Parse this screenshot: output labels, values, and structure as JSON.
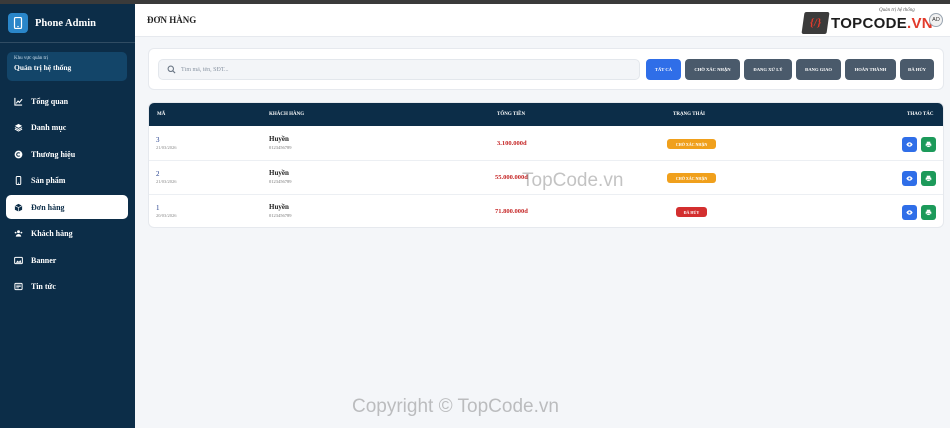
{
  "app": {
    "brand": "Phone Admin"
  },
  "area": {
    "subtitle": "Khu vực quản trị",
    "title": "Quản trị hệ thống"
  },
  "nav": {
    "items": [
      {
        "label": "Tổng quan",
        "icon": "chart-line-icon"
      },
      {
        "label": "Danh mục",
        "icon": "layers-icon"
      },
      {
        "label": "Thương hiệu",
        "icon": "copyright-icon"
      },
      {
        "label": "Sản phẩm",
        "icon": "mobile-icon"
      },
      {
        "label": "Đơn hàng",
        "icon": "box-icon",
        "active": true
      },
      {
        "label": "Khách hàng",
        "icon": "users-icon"
      },
      {
        "label": "Banner",
        "icon": "image-icon"
      },
      {
        "label": "Tin tức",
        "icon": "newspaper-icon"
      }
    ]
  },
  "header": {
    "title": "ĐƠN HÀNG",
    "logo_mark": "{/}",
    "logo_text_a": "TOPCODE",
    "logo_text_b": ".VN",
    "logo_slogan": "Quản trị hệ thống",
    "avatar": "AD"
  },
  "search": {
    "placeholder": "Tìm mã, tên, SĐT..."
  },
  "filters": [
    "Tất cả",
    "Chờ xác nhận",
    "Đang xử lý",
    "Đang giao",
    "Hoàn thành",
    "Đã hủy"
  ],
  "table": {
    "headers": {
      "id": "Mã",
      "customer": "Khách hàng",
      "total": "Tổng tiền",
      "status": "Trạng thái",
      "actions": "Thao tác"
    },
    "rows": [
      {
        "id": "3",
        "date": "21/03/2026",
        "name": "Huyền",
        "phone": "0123456789",
        "total": "3.100.000đ",
        "status": "Chờ xác nhận",
        "status_type": "pending"
      },
      {
        "id": "2",
        "date": "21/03/2026",
        "name": "Huyền",
        "phone": "0123456789",
        "total": "55.000.000đ",
        "status": "Chờ xác nhận",
        "status_type": "pending"
      },
      {
        "id": "1",
        "date": "20/03/2026",
        "name": "Huyền",
        "phone": "0123456789",
        "total": "71.800.000đ",
        "status": "Đã hủy",
        "status_type": "cancel"
      }
    ]
  },
  "watermarks": {
    "center": "TopCode.vn",
    "bottom": "Copyright © TopCode.vn"
  },
  "colors": {
    "sidebar": "#0c2d48",
    "primary": "#2f6ee8",
    "pending": "#f0a01c",
    "danger": "#d32f2f",
    "success": "#1c9a5a"
  }
}
